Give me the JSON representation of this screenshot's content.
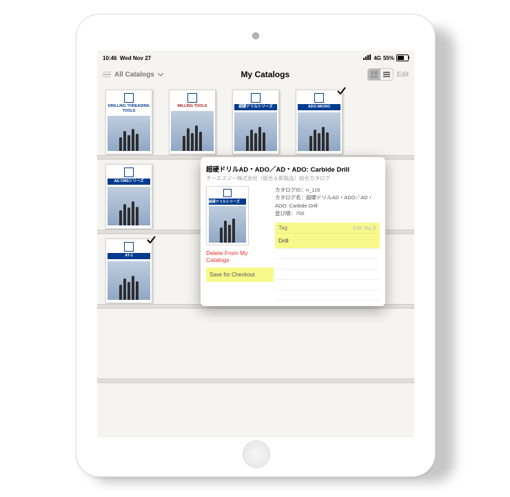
{
  "status": {
    "time": "10:46",
    "date": "Wed Nov 27",
    "network": "4G",
    "battery": "55%"
  },
  "nav": {
    "filter_label": "All Catalogs",
    "title": "My Catalogs",
    "edit_label": "Edit"
  },
  "catalogs": {
    "row1": [
      {
        "title": "DRILLING THREADING TOOLS"
      },
      {
        "title": "MILLING TOOLS",
        "title_color": "#b01818"
      },
      {
        "title": "超硬ドリルシリーズ",
        "title_color": "#ffffff",
        "banner": "#003b8e"
      },
      {
        "title": "ADO-MICRO",
        "title_color": "#ffffff",
        "banner": "#003b8e",
        "checked": true
      }
    ],
    "row2": [
      {
        "title": "AE-VMSシリーズ",
        "title_color": "#ffffff",
        "banner": "#003b8e"
      }
    ],
    "row3": [
      {
        "title": "AT-1",
        "title_color": "#ffffff",
        "banner": "#003b8e",
        "checked": true
      }
    ]
  },
  "popup": {
    "title": "超硬ドリルAD・ADO／AD・ADO: Carbide Drill",
    "subtitle": "オーエスジー株式会社（総合＆新製品）総合カタログ",
    "thumb_title": "超硬ドリルシリーズ",
    "meta_id_label": "カタログID：",
    "meta_id": "n_116",
    "meta_name_label": "カタログ名：",
    "meta_name": "超硬ドリルAD・ADO／AD・ADO: Carbide Drill",
    "meta_order_label": "並び順：",
    "meta_order": "700",
    "tag_header": "Tag",
    "edit_tag_label": "Edit Tag",
    "tag_value": "Drill",
    "delete_label": "Delete From My Catalogs",
    "save_label": "Save for Checkout"
  }
}
